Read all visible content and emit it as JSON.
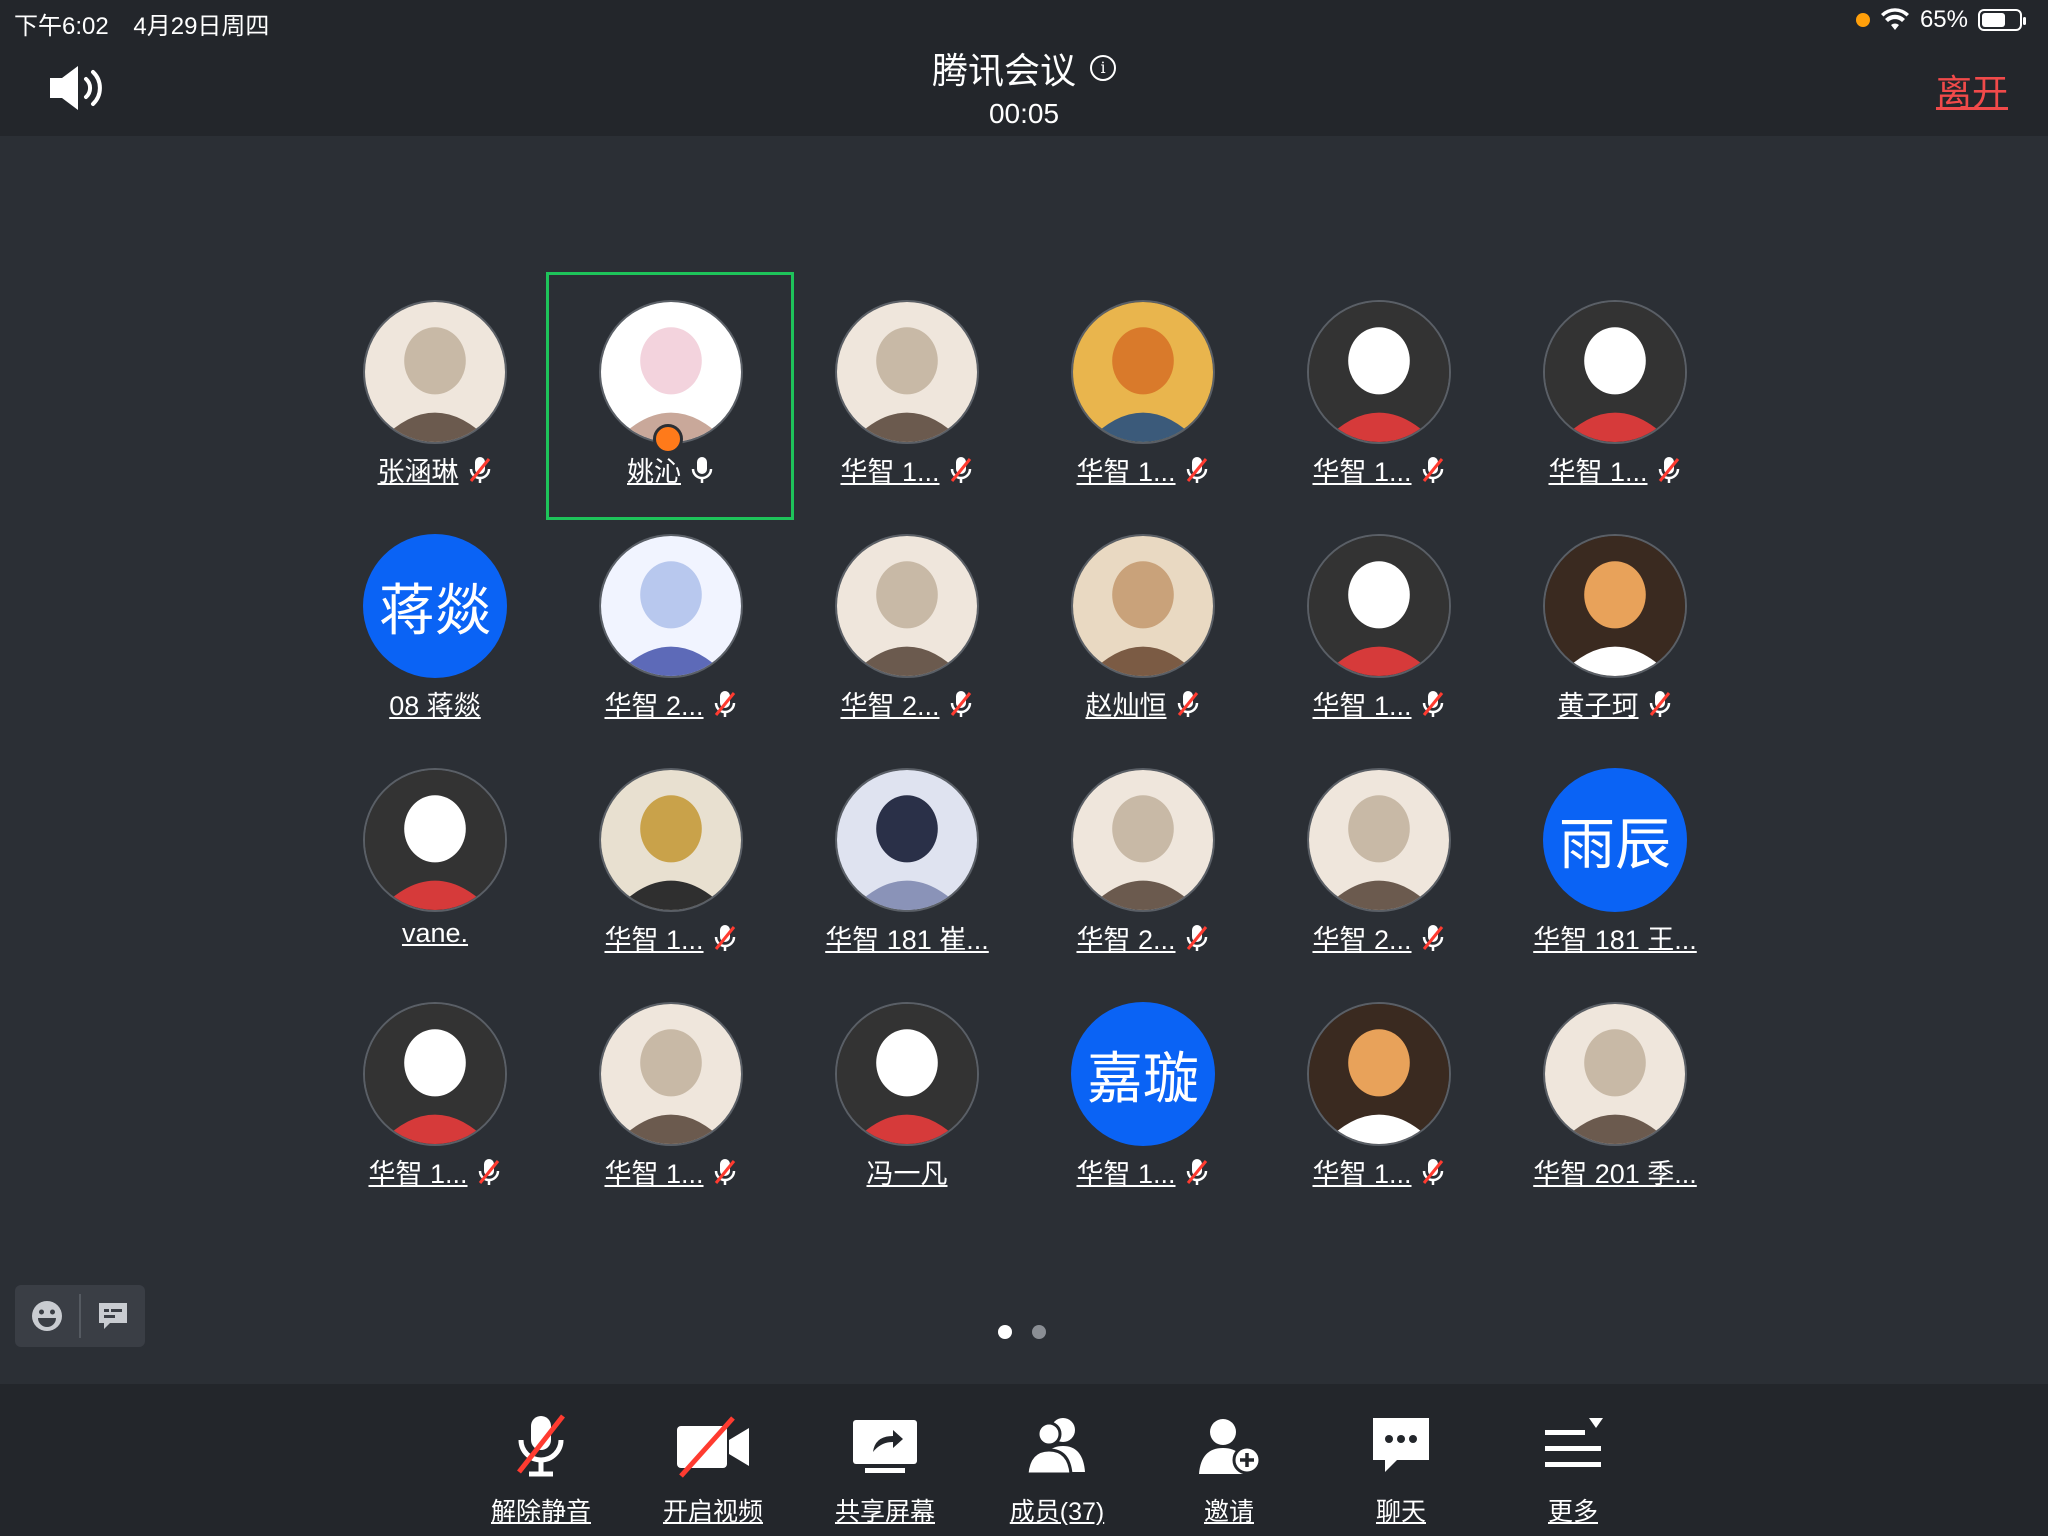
{
  "status_bar": {
    "time": "下午6:02",
    "date": "4月29日周四",
    "battery": "65%",
    "battery_level": 0.65
  },
  "header": {
    "title": "腾讯会议",
    "timer": "00:05",
    "leave_label": "离开"
  },
  "colors": {
    "background": "#2b2f35",
    "bar": "#23262b",
    "accent_blue": "#0a63f5",
    "leave_red": "#f14a4a",
    "active_speaker_border": "#1ec35a",
    "mute_red": "#ff3b30"
  },
  "participants": [
    {
      "name": "张涵琳",
      "mic": "muted",
      "avatar": "photo"
    },
    {
      "name": "姚沁",
      "mic": "on",
      "avatar": "cartoon-cat",
      "host": true,
      "active": true
    },
    {
      "name": "华智 1...",
      "mic": "muted",
      "avatar": "photo"
    },
    {
      "name": "华智 1...",
      "mic": "muted",
      "avatar": "painting"
    },
    {
      "name": "华智 1...",
      "mic": "muted",
      "avatar": "cartoon"
    },
    {
      "name": "华智 1...",
      "mic": "muted",
      "avatar": "cartoon"
    },
    {
      "name": "08 蒋燚",
      "mic": "none",
      "avatar": "text",
      "initials": "蒋燚"
    },
    {
      "name": "华智 2...",
      "mic": "muted",
      "avatar": "anime"
    },
    {
      "name": "华智 2...",
      "mic": "muted",
      "avatar": "photo"
    },
    {
      "name": "赵灿恒",
      "mic": "muted",
      "avatar": "cat-photo"
    },
    {
      "name": "华智 1...",
      "mic": "muted",
      "avatar": "cartoon"
    },
    {
      "name": "黄子珂",
      "mic": "muted",
      "avatar": "dog-photo"
    },
    {
      "name": "vane.",
      "mic": "none",
      "avatar": "cartoon"
    },
    {
      "name": "华智 1...",
      "mic": "muted",
      "avatar": "illustration"
    },
    {
      "name": "华智 181 崔...",
      "mic": "none",
      "avatar": "dark-art"
    },
    {
      "name": "华智 2...",
      "mic": "muted",
      "avatar": "photo"
    },
    {
      "name": "华智 2...",
      "mic": "muted",
      "avatar": "photo"
    },
    {
      "name": "华智 181 王...",
      "mic": "none",
      "avatar": "text",
      "initials": "雨辰"
    },
    {
      "name": "华智 1...",
      "mic": "muted",
      "avatar": "cartoon"
    },
    {
      "name": "华智 1...",
      "mic": "muted",
      "avatar": "photo"
    },
    {
      "name": "冯一凡",
      "mic": "none",
      "avatar": "cartoon"
    },
    {
      "name": "华智 1...",
      "mic": "muted",
      "avatar": "text",
      "initials": "嘉璇"
    },
    {
      "name": "华智 1...",
      "mic": "muted",
      "avatar": "dog-photo"
    },
    {
      "name": "华智 201 季...",
      "mic": "none",
      "avatar": "photo"
    }
  ],
  "pager": {
    "pages": 2,
    "current": 1
  },
  "toolbar": [
    {
      "label": "解除静音",
      "icon": "mic-muted-icon"
    },
    {
      "label": "开启视频",
      "icon": "video-off-icon"
    },
    {
      "label": "共享屏幕",
      "icon": "share-screen-icon"
    },
    {
      "label": "成员(37)",
      "icon": "members-icon"
    },
    {
      "label": "邀请",
      "icon": "invite-icon"
    },
    {
      "label": "聊天",
      "icon": "chat-icon"
    },
    {
      "label": "更多",
      "icon": "more-icon"
    }
  ]
}
